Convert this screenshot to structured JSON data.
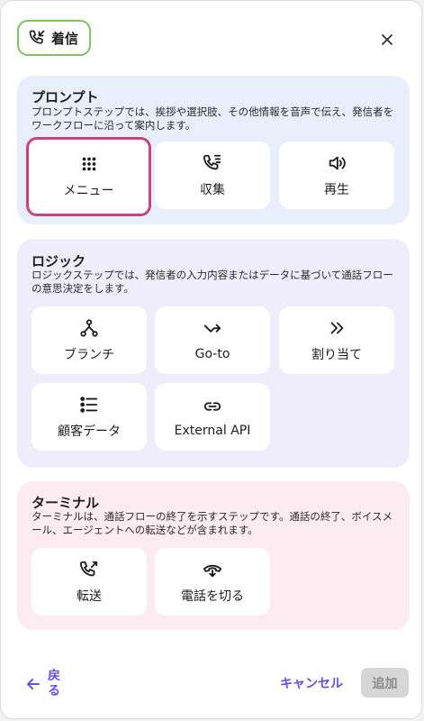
{
  "header": {
    "badge_label": "着信",
    "badge_color": "#7cc45c"
  },
  "sections": {
    "prompt": {
      "title": "プロンプト",
      "description": "プロンプトステップでは、挨拶や選択肢、その他情報を音声で伝え、発信者をワークフローに沿って案内します。",
      "bg": "#e8eefb",
      "items": [
        {
          "label": "メニュー",
          "icon": "dialpad-icon",
          "selected": true
        },
        {
          "label": "収集",
          "icon": "phone-collect-icon"
        },
        {
          "label": "再生",
          "icon": "speaker-icon"
        }
      ]
    },
    "logic": {
      "title": "ロジック",
      "description": "ロジックステップでは、発信者の入力内容またはデータに基づいて通話フローの意思決定をします。",
      "bg": "#efecfb",
      "items": [
        {
          "label": "ブランチ",
          "icon": "branch-icon"
        },
        {
          "label": "Go-to",
          "icon": "goto-arrow-icon"
        },
        {
          "label": "割り当て",
          "icon": "double-chevron-icon"
        },
        {
          "label": "顧客データ",
          "icon": "list-icon"
        },
        {
          "label": "External API",
          "icon": "link-icon"
        }
      ]
    },
    "terminal": {
      "title": "ターミナル",
      "description": "ターミナルは、通話フローの終了を示すステップです。通話の終了、ボイスメール、エージェントへの転送などが含まれます。",
      "bg": "#fcecf1",
      "items": [
        {
          "label": "転送",
          "icon": "phone-transfer-icon"
        },
        {
          "label": "電話を切る",
          "icon": "hang-up-icon"
        }
      ]
    }
  },
  "footer": {
    "back_label": "戻る",
    "cancel_label": "キャンセル",
    "add_label": "追加",
    "accent": "#6a4ee8"
  }
}
